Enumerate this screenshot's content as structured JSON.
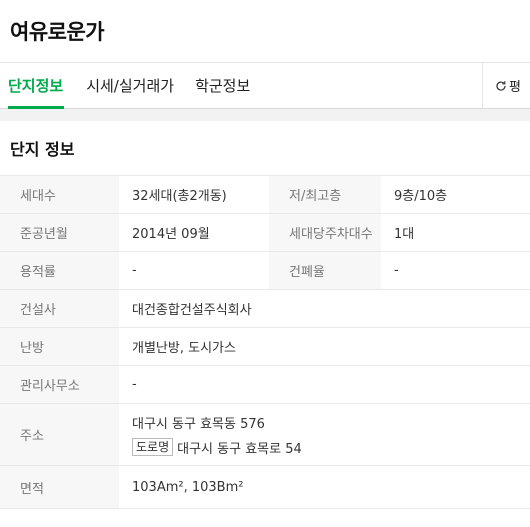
{
  "header": {
    "title": "여유로운가"
  },
  "tabs": [
    {
      "label": "단지정보",
      "active": true
    },
    {
      "label": "시세/실거래가",
      "active": false
    },
    {
      "label": "학군정보",
      "active": false
    }
  ],
  "refresh": {
    "label": "평",
    "icon": "refresh-icon"
  },
  "section": {
    "title": "단지 정보"
  },
  "info": {
    "households_label": "세대수",
    "households_value": "32세대(총2개동)",
    "floors_label": "저/최고층",
    "floors_value": "9층/10층",
    "completion_label": "준공년월",
    "completion_value": "2014년 09월",
    "parking_label": "세대당주차대수",
    "parking_value": "1대",
    "far_label": "용적률",
    "far_value": "-",
    "bcr_label": "건폐율",
    "bcr_value": "-",
    "builder_label": "건설사",
    "builder_value": "대건종합건설주식회사",
    "heating_label": "난방",
    "heating_value": "개별난방, 도시가스",
    "office_label": "관리사무소",
    "office_value": "-",
    "address_label": "주소",
    "address_jibun": "대구시 동구 효목동 576",
    "road_badge": "도로명",
    "address_road": "대구시 동구 효목로 54",
    "area_label": "면적",
    "area_value": "103Am², 103Bm²"
  },
  "colors": {
    "accent": "#03a94d",
    "key_bg": "#f7f7f7",
    "gap_bg": "#f2f2f2"
  }
}
